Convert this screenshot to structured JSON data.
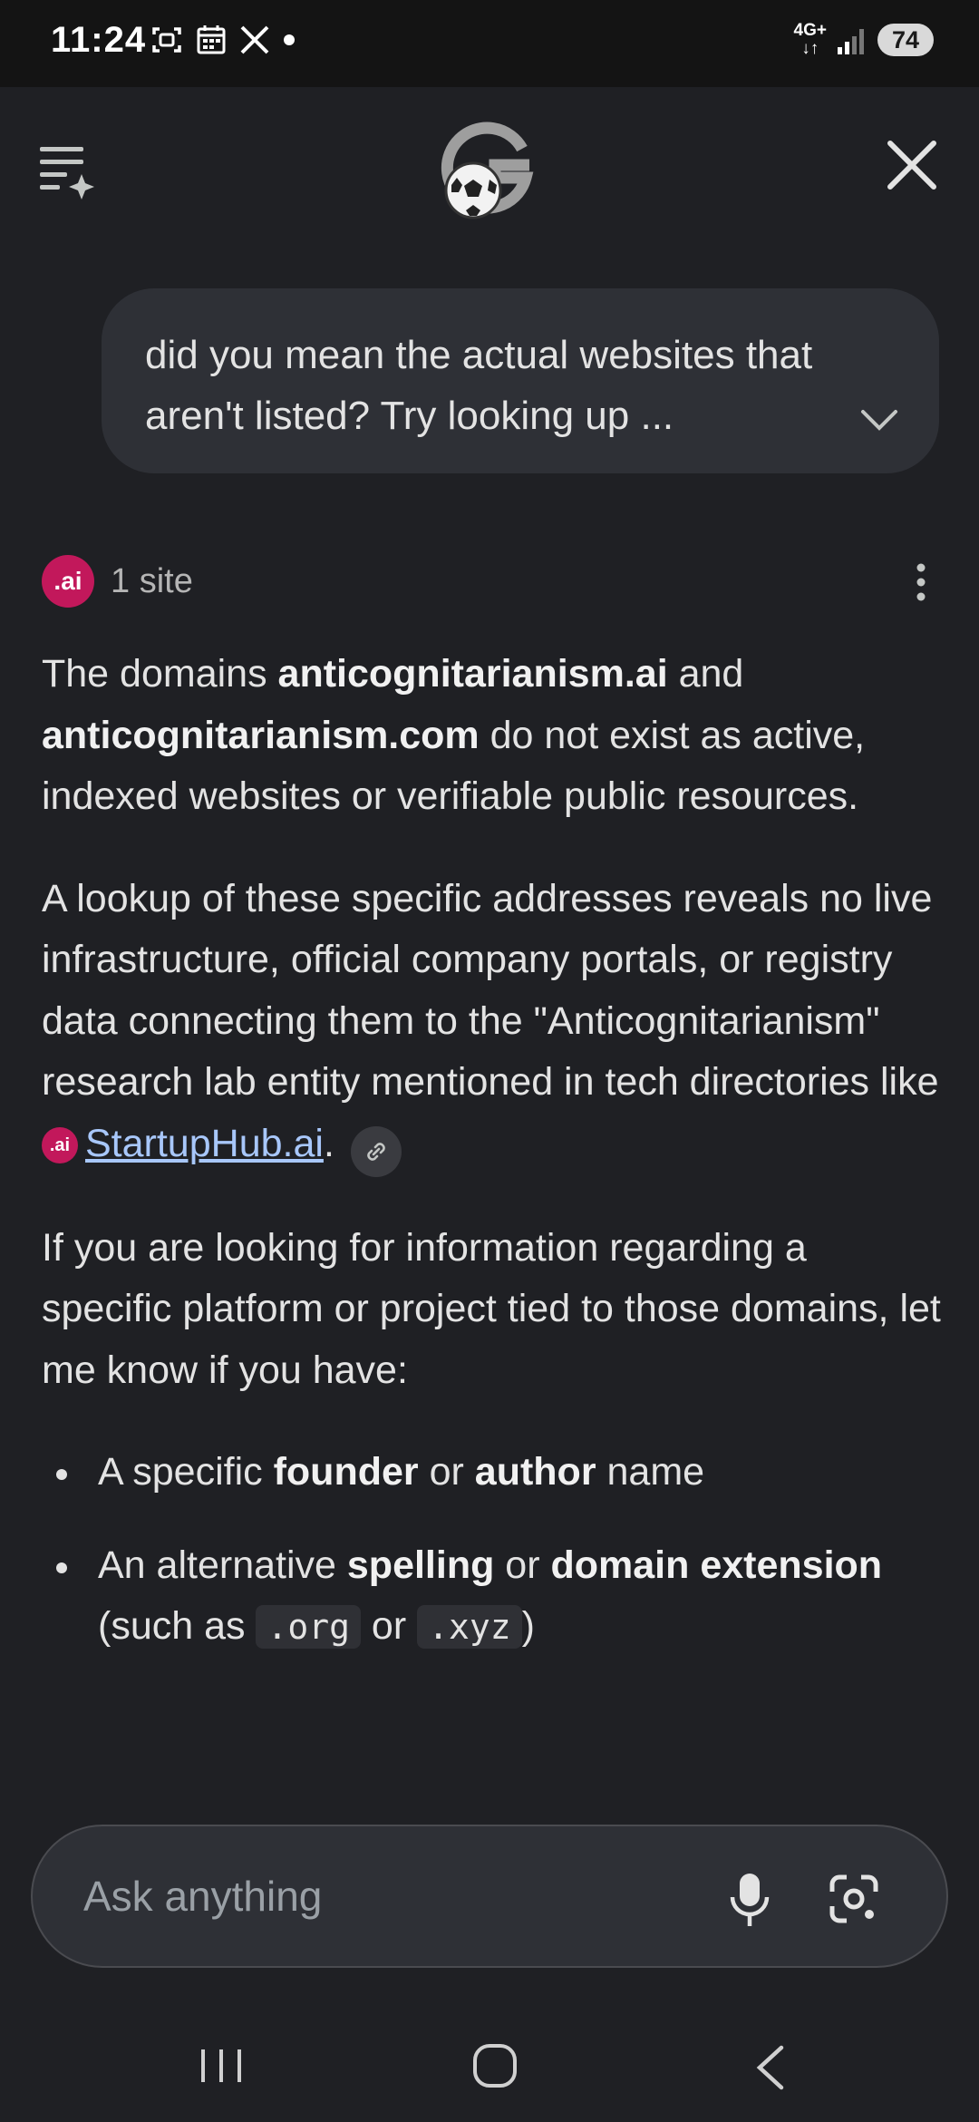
{
  "status": {
    "time": "11:24",
    "network": "4G+",
    "battery": "74"
  },
  "query": {
    "text": "did you mean the actual websites that aren't listed? Try looking up ..."
  },
  "sources": {
    "badge": ".ai",
    "count_label": "1 site"
  },
  "answer": {
    "p1": {
      "t1": "The domains ",
      "b1": "anticognitarianism.ai",
      "t2": " and ",
      "b2": "anticognitarianism.com",
      "t3": " do not exist as active, indexed websites or verifiable public resources."
    },
    "p2": {
      "t1": "A lookup of these specific addresses reveals no live infrastructure, official company portals, or registry data connecting them to the \"Anticognitarianism\" research lab entity mentioned in tech directories like ",
      "badge": ".ai",
      "link": "StartupHub.ai",
      "t2": "."
    },
    "p3": {
      "text": "If you are looking for information regarding a specific platform or project tied to those domains, let me know if you have:"
    },
    "bullets": [
      {
        "t1": "A specific ",
        "b1": "founder",
        "t2": " or ",
        "b2": "author",
        "t3": " name"
      },
      {
        "t1": "An alternative ",
        "b1": "spelling",
        "t2": " or ",
        "b2": "domain extension",
        "t3": " (such as ",
        "c1": ".org",
        "t4": " or ",
        "c2": ".xyz",
        "t5": ")"
      }
    ]
  },
  "input": {
    "placeholder": "Ask anything"
  },
  "icons": {
    "menu": "menu-sparkle-icon",
    "logo": "soccer-g-logo",
    "close": "close-icon",
    "chevron": "chevron-down-icon",
    "kebab": "more-vert-icon",
    "link": "link-icon",
    "mic": "mic-icon",
    "lens": "camera-lens-icon"
  },
  "colors": {
    "background": "#1f2024",
    "bubble": "#2e3036",
    "link": "#a8c7fa",
    "site_badge": "#c2185b"
  }
}
